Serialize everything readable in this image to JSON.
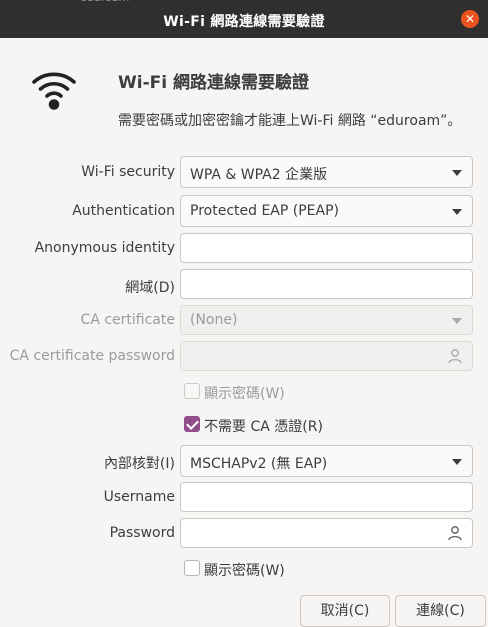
{
  "window": {
    "title": "Wi-Fi 網路連線需要驗證",
    "ghost_text": "eduroam",
    "close_icon": "close-icon"
  },
  "header": {
    "heading": "Wi-Fi 網路連線需要驗證",
    "message": "需要密碼或加密密鑰才能連上Wi-Fi 網路 “eduroam”。",
    "icon": "wifi-icon"
  },
  "form": {
    "wifi_security": {
      "label": "Wi-Fi security",
      "value": "WPA & WPA2 企業版"
    },
    "authentication": {
      "label": "Authentication",
      "value": "Protected EAP (PEAP)"
    },
    "anonymous_identity": {
      "label": "Anonymous identity",
      "value": ""
    },
    "domain": {
      "label": "網域(D)",
      "value": ""
    },
    "ca_certificate": {
      "label": "CA certificate",
      "value": "(None)"
    },
    "ca_certificate_password": {
      "label": "CA certificate password",
      "value": ""
    },
    "show_ca_password": {
      "label": "顯示密碼(W)",
      "checked": false
    },
    "no_ca_required": {
      "label": "不需要 CA 憑證(R)",
      "checked": true
    },
    "inner_auth": {
      "label": "內部核對(I)",
      "value": "MSCHAPv2 (無 EAP)"
    },
    "username": {
      "label": "Username",
      "value": ""
    },
    "password": {
      "label": "Password",
      "value": ""
    },
    "show_password": {
      "label": "顯示密碼(W)",
      "checked": false
    }
  },
  "buttons": {
    "cancel": "取消(C)",
    "connect": "連線(C)"
  },
  "colors": {
    "titlebar": "#2f2f2f",
    "close": "#e95420",
    "checkbox_accent": "#924d8b"
  }
}
